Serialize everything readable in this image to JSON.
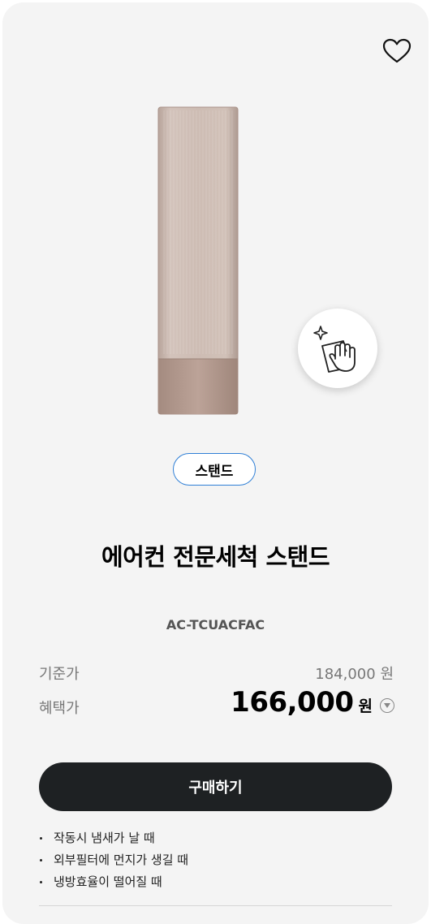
{
  "product": {
    "category_tag": "스탠드",
    "title": "에어컨 전문세척 스탠드",
    "model": "AC-TCUACFAC"
  },
  "pricing": {
    "base_label": "기준가",
    "base_price": "184,000 원",
    "sale_label": "혜택가",
    "sale_price": "166,000",
    "sale_unit": "원"
  },
  "actions": {
    "buy_label": "구매하기",
    "wishlist_icon": "heart-icon",
    "price_info_icon": "chevron-down-circle-icon"
  },
  "features": [
    "작동시 냄새가 날 때",
    "외부필터에 먼지가 생길 때",
    "냉방효율이 떨어질 때"
  ],
  "colors": {
    "card_bg": "#f4f4f4",
    "tag_border": "#2f7fd6",
    "buy_button_bg": "#1e2123",
    "product_body": "#c9b7ae",
    "product_base": "#b49a8f"
  }
}
